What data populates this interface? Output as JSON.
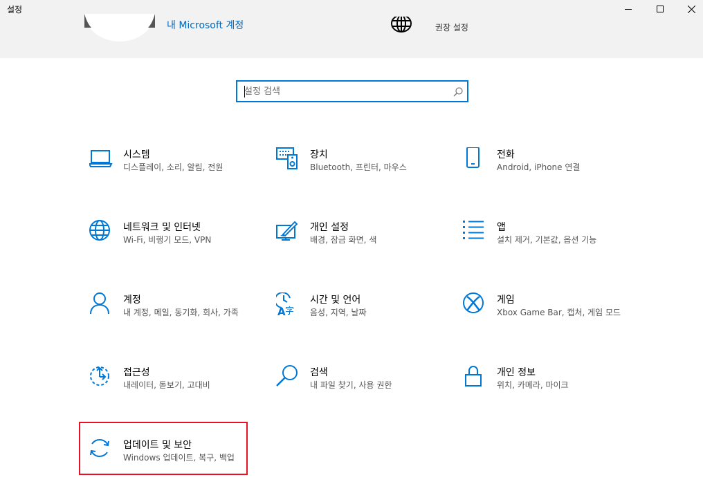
{
  "window": {
    "title": "설정",
    "controls": {
      "minimize": "minimize-icon",
      "maximize": "maximize-icon",
      "close": "close-icon"
    }
  },
  "header": {
    "account_link": "내 Microsoft 계정",
    "recommended_settings": "권장 설정"
  },
  "search": {
    "placeholder": "설정 검색",
    "value": ""
  },
  "tiles": [
    {
      "icon": "laptop-icon",
      "title": "시스템",
      "desc": "디스플레이, 소리, 알림, 전원"
    },
    {
      "icon": "devices-icon",
      "title": "장치",
      "desc": "Bluetooth, 프린터, 마우스"
    },
    {
      "icon": "phone-icon",
      "title": "전화",
      "desc": "Android, iPhone 연결"
    },
    {
      "icon": "globe-icon",
      "title": "네트워크 및 인터넷",
      "desc": "Wi-Fi, 비행기 모드, VPN"
    },
    {
      "icon": "personalization-icon",
      "title": "개인 설정",
      "desc": "배경, 잠금 화면, 색"
    },
    {
      "icon": "apps-list-icon",
      "title": "앱",
      "desc": "설치 제거, 기본값, 옵션 기능"
    },
    {
      "icon": "person-icon",
      "title": "계정",
      "desc": "내 계정, 메일, 동기화, 회사, 가족"
    },
    {
      "icon": "time-language-icon",
      "title": "시간 및 언어",
      "desc": "음성, 지역, 날짜"
    },
    {
      "icon": "xbox-icon",
      "title": "게임",
      "desc": "Xbox Game Bar, 캡처, 게임 모드"
    },
    {
      "icon": "accessibility-icon",
      "title": "접근성",
      "desc": "내레이터, 돋보기, 고대비"
    },
    {
      "icon": "search-magnifier-icon",
      "title": "검색",
      "desc": "내 파일 찾기, 사용 권한"
    },
    {
      "icon": "lock-icon",
      "title": "개인 정보",
      "desc": "위치, 카메라, 마이크"
    },
    {
      "icon": "update-sync-icon",
      "title": "업데이트 및 보안",
      "desc": "Windows 업데이트, 복구, 백업"
    }
  ],
  "colors": {
    "accent": "#0078d7",
    "highlight_border": "#e81123",
    "header_bg": "#f2f2f2"
  }
}
